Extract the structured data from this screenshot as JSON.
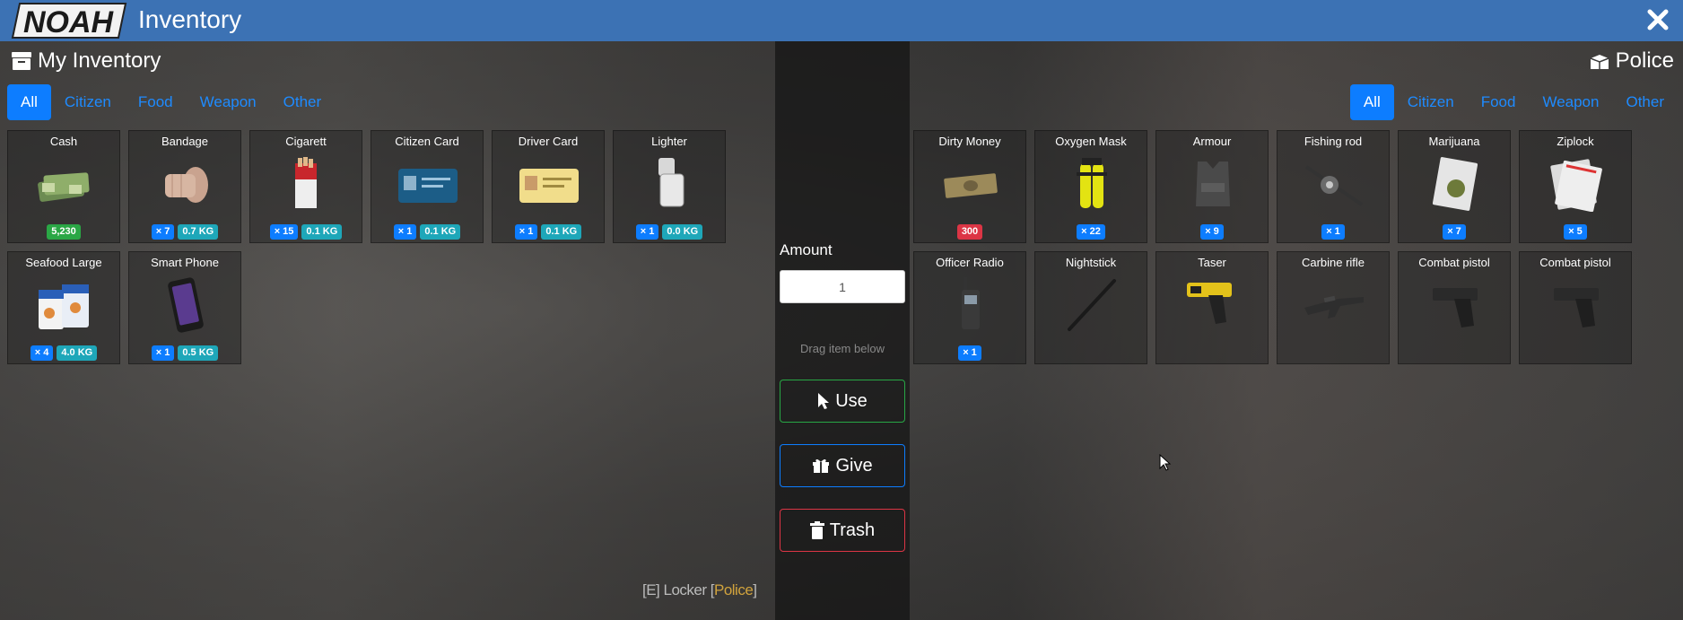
{
  "window": {
    "title": "Inventory",
    "logo_text": "NOAH"
  },
  "left": {
    "title": "My Inventory",
    "tabs": [
      {
        "label": "All",
        "active": true
      },
      {
        "label": "Citizen"
      },
      {
        "label": "Food"
      },
      {
        "label": "Weapon"
      },
      {
        "label": "Other"
      }
    ],
    "items": [
      {
        "name": "Cash",
        "icon": "cash-icon",
        "money": "5,230"
      },
      {
        "name": "Bandage",
        "icon": "bandage-icon",
        "count": "× 7",
        "weight": "0.7 KG"
      },
      {
        "name": "Cigarett",
        "icon": "cigarette-icon",
        "count": "× 15",
        "weight": "0.1 KG"
      },
      {
        "name": "Citizen Card",
        "icon": "id-card-icon",
        "count": "× 1",
        "weight": "0.1 KG"
      },
      {
        "name": "Driver Card",
        "icon": "driver-license-icon",
        "count": "× 1",
        "weight": "0.1 KG"
      },
      {
        "name": "Lighter",
        "icon": "lighter-icon",
        "count": "× 1",
        "weight": "0.0 KG"
      },
      {
        "name": "Seafood Large",
        "icon": "seafood-icon",
        "count": "× 4",
        "weight": "4.0 KG"
      },
      {
        "name": "Smart Phone",
        "icon": "phone-icon",
        "count": "× 1",
        "weight": "0.5 KG"
      }
    ]
  },
  "middle": {
    "amount_label": "Amount",
    "amount_value": "1",
    "drag_hint": "Drag item below",
    "use_label": "Use",
    "give_label": "Give",
    "trash_label": "Trash",
    "locker_prefix": "[E] Locker [",
    "locker_name": "Police",
    "locker_suffix": "]"
  },
  "right": {
    "title": "Police",
    "tabs": [
      {
        "label": "All",
        "active": true
      },
      {
        "label": "Citizen"
      },
      {
        "label": "Food"
      },
      {
        "label": "Weapon"
      },
      {
        "label": "Other"
      }
    ],
    "items": [
      {
        "name": "Dirty Money",
        "icon": "dirty-money-icon",
        "dirty": "300"
      },
      {
        "name": "Oxygen Mask",
        "icon": "oxygen-tank-icon",
        "count": "× 22"
      },
      {
        "name": "Armour",
        "icon": "armour-vest-icon",
        "count": "× 9"
      },
      {
        "name": "Fishing rod",
        "icon": "fishing-rod-icon",
        "count": "× 1"
      },
      {
        "name": "Marijuana",
        "icon": "marijuana-bag-icon",
        "count": "× 7"
      },
      {
        "name": "Ziplock",
        "icon": "ziplock-icon",
        "count": "× 5"
      },
      {
        "name": "Officer Radio",
        "icon": "radio-icon",
        "count": "× 1"
      },
      {
        "name": "Nightstick",
        "icon": "nightstick-icon"
      },
      {
        "name": "Taser",
        "icon": "taser-icon"
      },
      {
        "name": "Carbine rifle",
        "icon": "rifle-icon"
      },
      {
        "name": "Combat pistol",
        "icon": "pistol-icon"
      },
      {
        "name": "Combat pistol",
        "icon": "pistol-icon"
      }
    ]
  }
}
